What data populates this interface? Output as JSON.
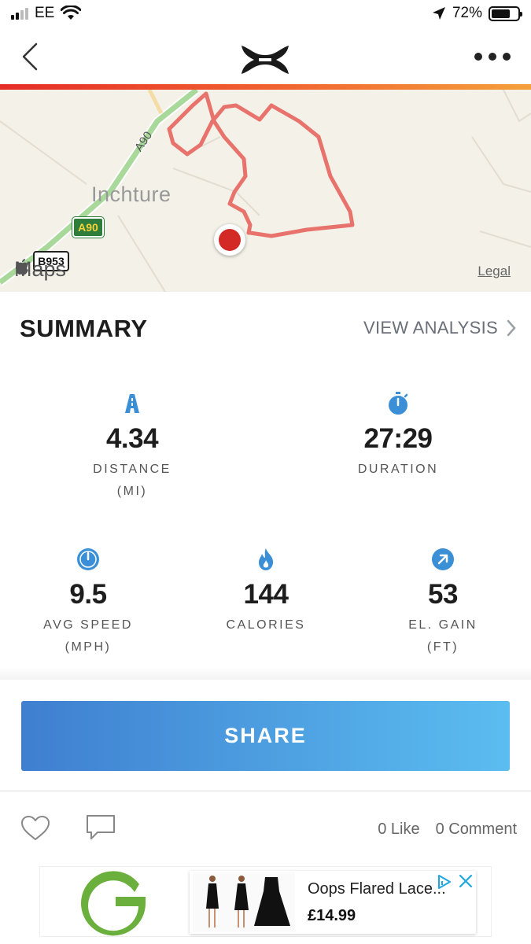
{
  "status_bar": {
    "carrier": "EE",
    "battery_text": "72%",
    "battery_level": 0.72
  },
  "header": {
    "back_icon": "chevron-left-icon",
    "logo": "under-armour-logo",
    "more_icon": "ellipsis-icon"
  },
  "map": {
    "place_label": "Inchture",
    "road_a90_badge": "A90",
    "road_a90_label": "A90",
    "road_b953_badge": "B953",
    "maps_brand": "Maps",
    "legal": "Legal",
    "route_color": "#e8736c",
    "marker_color": "#d42a26"
  },
  "summary": {
    "title": "SUMMARY",
    "view_analysis": "VIEW ANALYSIS",
    "stats": {
      "distance": {
        "value": "4.34",
        "label": "DISTANCE",
        "unit": "(MI)",
        "icon": "road-icon"
      },
      "duration": {
        "value": "27:29",
        "label": "DURATION",
        "icon": "stopwatch-icon"
      },
      "avg_speed": {
        "value": "9.5",
        "label": "AVG SPEED",
        "unit": "(MPH)",
        "icon": "speedometer-icon"
      },
      "calories": {
        "value": "144",
        "label": "CALORIES",
        "icon": "flame-icon"
      },
      "elevation": {
        "value": "53",
        "label": "EL. GAIN",
        "unit": "(FT)",
        "icon": "arrow-up-right-icon"
      }
    },
    "icon_color": "#3a8fd6"
  },
  "share": {
    "label": "SHARE"
  },
  "social": {
    "likes": "0 Like",
    "comments": "0 Comment"
  },
  "ad": {
    "title": "Oops Flared Lace...",
    "price": "£14.99",
    "brand_color": "#6bb03c"
  }
}
